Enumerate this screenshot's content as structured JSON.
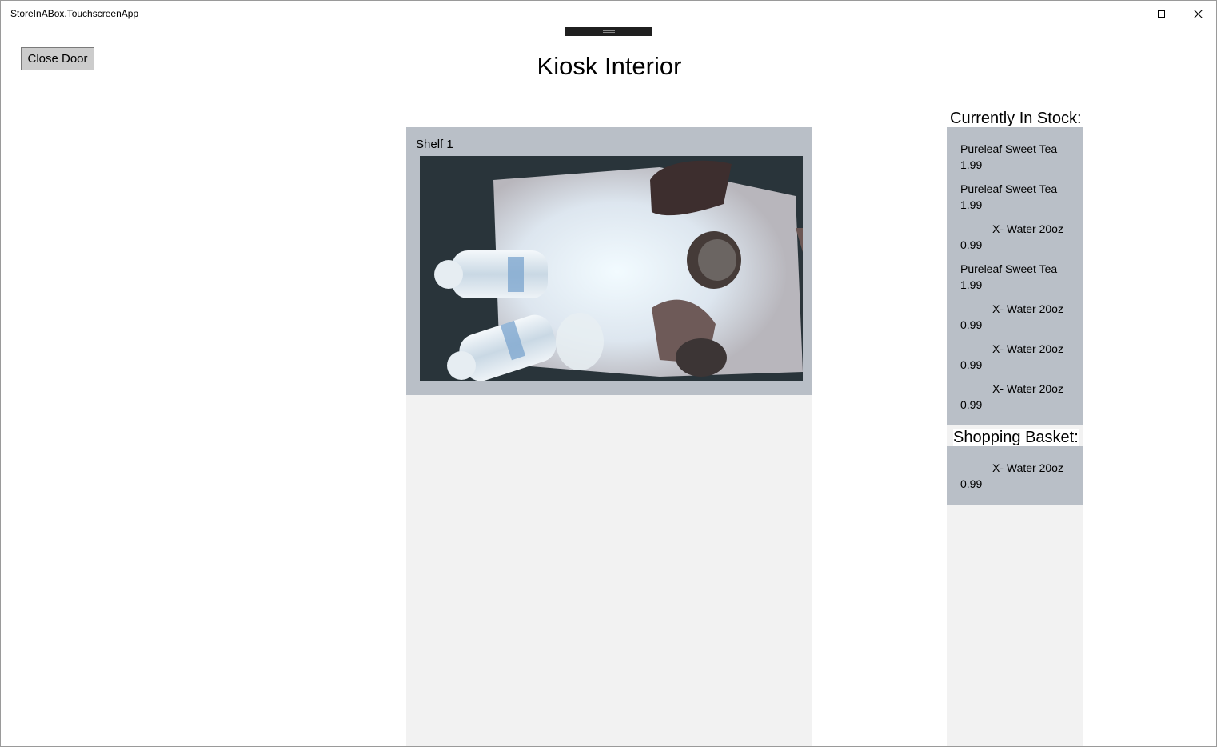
{
  "window": {
    "title": "StoreInABox.TouchscreenApp"
  },
  "toolbar": {
    "close_door_label": "Close Door"
  },
  "page": {
    "title": "Kiosk Interior"
  },
  "shelf": {
    "label": "Shelf 1",
    "image_alt": "Camera view of shelf with water bottles and tea bottles"
  },
  "stock": {
    "heading": "Currently In Stock:",
    "items": [
      {
        "name": "Pureleaf Sweet Tea",
        "price": "1.99"
      },
      {
        "name": "Pureleaf Sweet Tea",
        "price": "1.99"
      },
      {
        "name": "X- Water 20oz",
        "price": "0.99"
      },
      {
        "name": "Pureleaf Sweet Tea",
        "price": "1.99"
      },
      {
        "name": "X- Water 20oz",
        "price": "0.99"
      },
      {
        "name": "X- Water 20oz",
        "price": "0.99"
      },
      {
        "name": "X- Water 20oz",
        "price": "0.99"
      }
    ]
  },
  "basket": {
    "heading": "Shopping Basket:",
    "items": [
      {
        "name": "X- Water 20oz",
        "price": "0.99"
      }
    ]
  },
  "colors": {
    "panel": "#b9bfc7",
    "column": "#f2f2f2",
    "button": "#cccccc"
  },
  "icons": {
    "minimize": "minimize-icon",
    "maximize": "maximize-icon",
    "close": "close-icon"
  }
}
